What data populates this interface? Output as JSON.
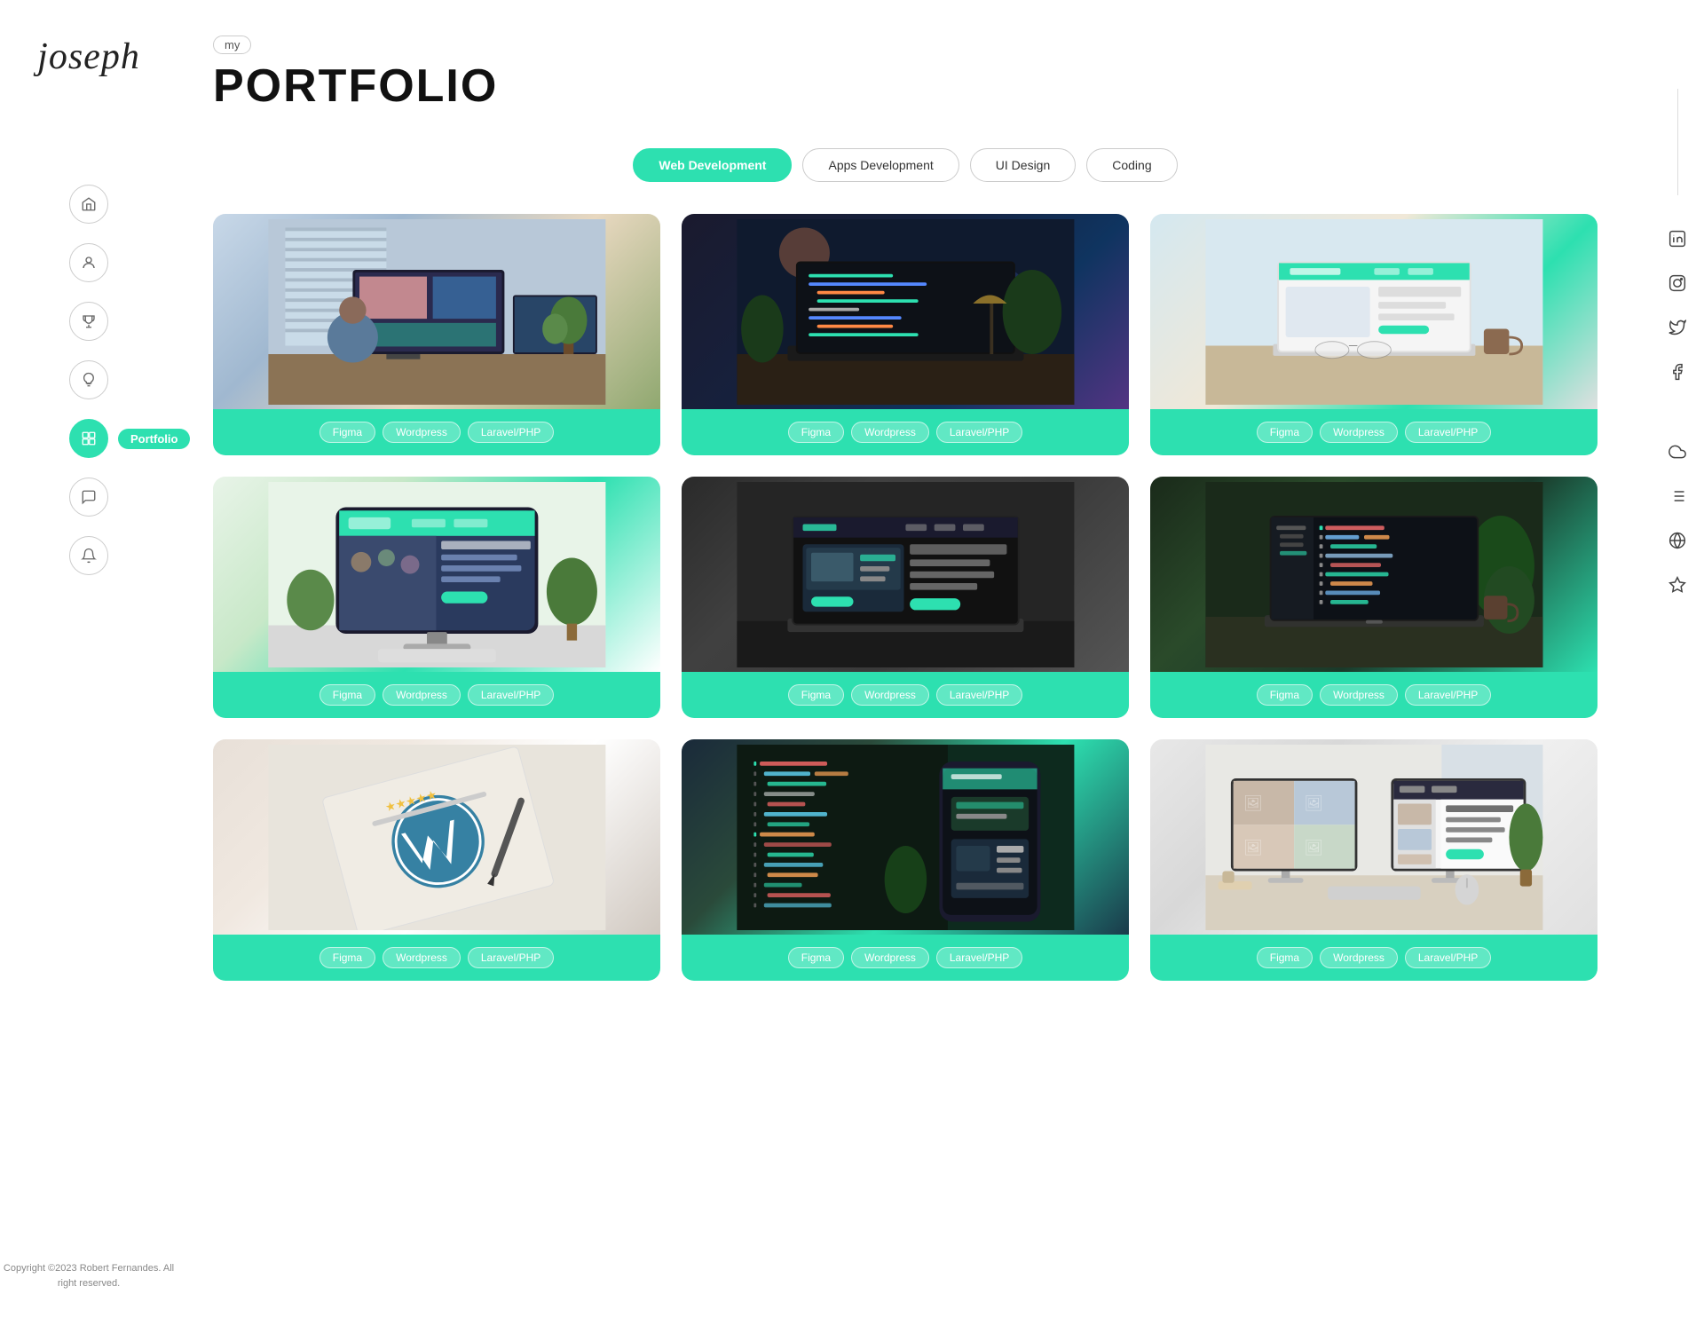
{
  "logo": "joseph",
  "header": {
    "subtitle": "my",
    "title": "PORTFOLIO"
  },
  "nav": {
    "items": [
      {
        "id": "home",
        "icon": "home-icon"
      },
      {
        "id": "profile",
        "icon": "user-icon"
      },
      {
        "id": "trophy",
        "icon": "trophy-icon"
      },
      {
        "id": "bulb",
        "icon": "bulb-icon"
      },
      {
        "id": "portfolio",
        "icon": "grid-icon",
        "active": true,
        "label": "Portfolio"
      },
      {
        "id": "chat",
        "icon": "chat-icon"
      },
      {
        "id": "bell",
        "icon": "bell-icon"
      }
    ]
  },
  "filters": {
    "tabs": [
      {
        "id": "web",
        "label": "Web Development",
        "active": true
      },
      {
        "id": "apps",
        "label": "Apps Development",
        "active": false
      },
      {
        "id": "ui",
        "label": "UI Design",
        "active": false
      },
      {
        "id": "coding",
        "label": "Coding",
        "active": false
      }
    ]
  },
  "portfolio": {
    "cards": [
      {
        "id": 1,
        "tags": [
          "Figma",
          "Wordpress",
          "Laravel/PHP"
        ],
        "img_class": "img-1",
        "alt": "Developer at desk with multiple monitors"
      },
      {
        "id": 2,
        "tags": [
          "Figma",
          "Wordpress",
          "Laravel/PHP"
        ],
        "img_class": "img-2",
        "alt": "Laptop with code editor dark theme"
      },
      {
        "id": 3,
        "tags": [
          "Figma",
          "Wordpress",
          "Laravel/PHP"
        ],
        "img_class": "img-3",
        "alt": "Laptop with website open on desk"
      },
      {
        "id": 4,
        "tags": [
          "Figma",
          "Wordpress",
          "Laravel/PHP"
        ],
        "img_class": "img-4",
        "alt": "iMac with website design"
      },
      {
        "id": 5,
        "tags": [
          "Figma",
          "Wordpress",
          "Laravel/PHP"
        ],
        "img_class": "img-5",
        "alt": "Laptop with landing page dark"
      },
      {
        "id": 6,
        "tags": [
          "Figma",
          "Wordpress",
          "Laravel/PHP"
        ],
        "img_class": "img-6",
        "alt": "Laptop with code open on desk"
      },
      {
        "id": 7,
        "tags": [
          "Figma",
          "Wordpress",
          "Laravel/PHP"
        ],
        "img_class": "img-7",
        "alt": "WordPress logo closeup"
      },
      {
        "id": 8,
        "tags": [
          "Figma",
          "Wordpress",
          "Laravel/PHP"
        ],
        "img_class": "img-8",
        "alt": "Code and phone mockup"
      },
      {
        "id": 9,
        "tags": [
          "Figma",
          "Wordpress",
          "Laravel/PHP"
        ],
        "img_class": "img-9",
        "alt": "Dual monitor workspace"
      }
    ]
  },
  "social": {
    "links": [
      {
        "id": "linkedin",
        "icon": "in"
      },
      {
        "id": "instagram",
        "icon": "ig"
      },
      {
        "id": "twitter",
        "icon": "tw"
      },
      {
        "id": "facebook",
        "icon": "fb"
      }
    ]
  },
  "right_icons": [
    {
      "id": "cloud",
      "icon": "cloud-icon"
    },
    {
      "id": "list",
      "icon": "list-icon"
    },
    {
      "id": "globe",
      "icon": "globe-icon"
    },
    {
      "id": "star",
      "icon": "star-icon"
    }
  ],
  "copyright": "Copyright ©2023 Robert\nFernandes. All right reserved."
}
